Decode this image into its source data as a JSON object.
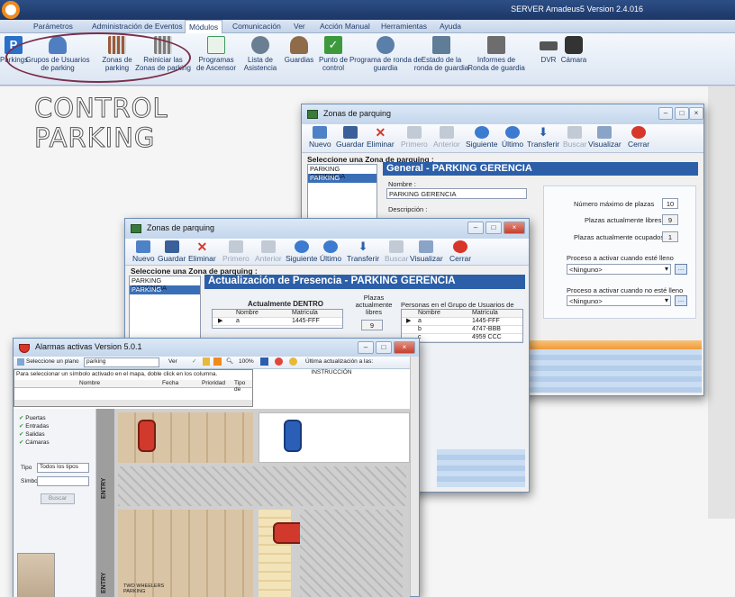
{
  "app": {
    "title": "SERVER Amadeus5 Version 2.4.016"
  },
  "menu": [
    "Parámetros",
    "Administración de Eventos",
    "Módulos",
    "Comunicación",
    "Ver",
    "Acción Manual",
    "Herramientas",
    "Ayuda"
  ],
  "menu_active": "Módulos",
  "ribbon": [
    {
      "label": "Parkings",
      "color": "#2a6fc9"
    },
    {
      "label": "Grupos de Usuarios de parking",
      "color": "#4f7fc1"
    },
    {
      "label": "Zonas de parking",
      "color": "#9a5a3a"
    },
    {
      "label": "Reiniciar las Zonas de parking",
      "color": "#7e7e7e"
    },
    {
      "label": "Programas de Ascensor",
      "color": "#3e9a5c"
    },
    {
      "label": "Lista de Asistencia",
      "color": "#6b7f92"
    },
    {
      "label": "Guardias",
      "color": "#8f6b4a"
    },
    {
      "label": "Punto de control",
      "color": "#3c9a3c"
    },
    {
      "label": "Programa de ronda de guardia",
      "color": "#5a7fa8"
    },
    {
      "label": "Estado de la ronda de guardia",
      "color": "#5f7d96"
    },
    {
      "label": "Informes de Ronda de guardia",
      "color": "#6d6d6d"
    },
    {
      "label": "DVR",
      "color": "#555555"
    },
    {
      "label": "Cámara",
      "color": "#333333"
    }
  ],
  "heading": {
    "line1": "CONTROL",
    "line2": "PARKING"
  },
  "toolbar": {
    "nuevo": "Nuevo",
    "guardar": "Guardar",
    "eliminar": "Eliminar",
    "primero": "Primero",
    "anterior": "Anterior",
    "siguiente": "Siguiente",
    "ultimo": "Último",
    "transferir": "Transferir",
    "buscar": "Buscar",
    "visualizar": "Visualizar",
    "cerrar": "Cerrar"
  },
  "zonas_window_back": {
    "title": "Zonas de parquing",
    "select_label": "Seleccione una Zona de parquing :",
    "zones": [
      "PARKING GERENCIA",
      "PARKING GERENCIA"
    ],
    "header": "General - PARKING GERENCIA",
    "nombre_label": "Nombre :",
    "nombre_value": "PARKING GERENCIA",
    "descripcion_label": "Descripción :",
    "max_label": "Número máximo de plazas",
    "max_value": "10",
    "libres_label": "Plazas actualmente libres",
    "libres_value": "9",
    "ocupados_label": "Plazas actualmente ocupados",
    "ocupados_value": "1",
    "proc_lleno_label": "Proceso a activar cuando esté lleno",
    "proc_lleno_value": "<Ninguno>",
    "proc_no_lleno_label": "Proceso a activar cuando no esté lleno",
    "proc_no_lleno_value": "<Ninguno>"
  },
  "zonas_window_front": {
    "title": "Zonas de parquing",
    "select_label": "Seleccione una Zona de parquing :",
    "zones": [
      "PARKING GERENCIA",
      "PARKING GERENCIA"
    ],
    "header": "Actualización de Presencia - PARKING GERENCIA",
    "dentro_label": "Actualmente DENTRO",
    "dentro_cols": [
      "Nombre",
      "Matrícula"
    ],
    "dentro_rows": [
      [
        "a",
        "1445-FFF"
      ]
    ],
    "plazas_libres_label": "Plazas actualmente libres",
    "plazas_libres_value": "9",
    "grupo_label": "Personas en el Grupo de Usuarios de parqui",
    "grupo_cols": [
      "Nombre",
      "Matrícula"
    ],
    "grupo_rows": [
      [
        "a",
        "1445-FFF"
      ],
      [
        "b",
        "4747-BBB"
      ],
      [
        "c",
        "4959 CCC"
      ]
    ]
  },
  "alarmas_window": {
    "title": "Alarmas activas Version 5.0.1",
    "toolbar_plano": "Seleccione un plano",
    "plano_value": "parking",
    "ver": "Ver",
    "zoom": "100%",
    "activacion": "Última actualización a las:",
    "hint": "Para seleccionar un símbolo activado en el mapa, doble click en los columna.",
    "cols": [
      "Nombre",
      "Fecha",
      "Prioridad",
      "Tipo de"
    ],
    "instruccion": "INSTRUCCIÓN",
    "legend": [
      "Puertas",
      "Entradas",
      "Salidas",
      "Cámaras"
    ],
    "tipo_label": "Tipo",
    "tipo_value": "Todos los tipos",
    "simbol_label": "Símbolo",
    "buscar": "Buscar",
    "entry1": "ENTRY",
    "entry2": "ENTRY",
    "wheelchair": "TWO WHEELERS PARKING",
    "pm_label": "ENTRADA MOTOS"
  },
  "colors": {
    "accent": "#2c5fa8",
    "title_bar": "#1c3666",
    "orange_bar": "#f5a64a"
  }
}
